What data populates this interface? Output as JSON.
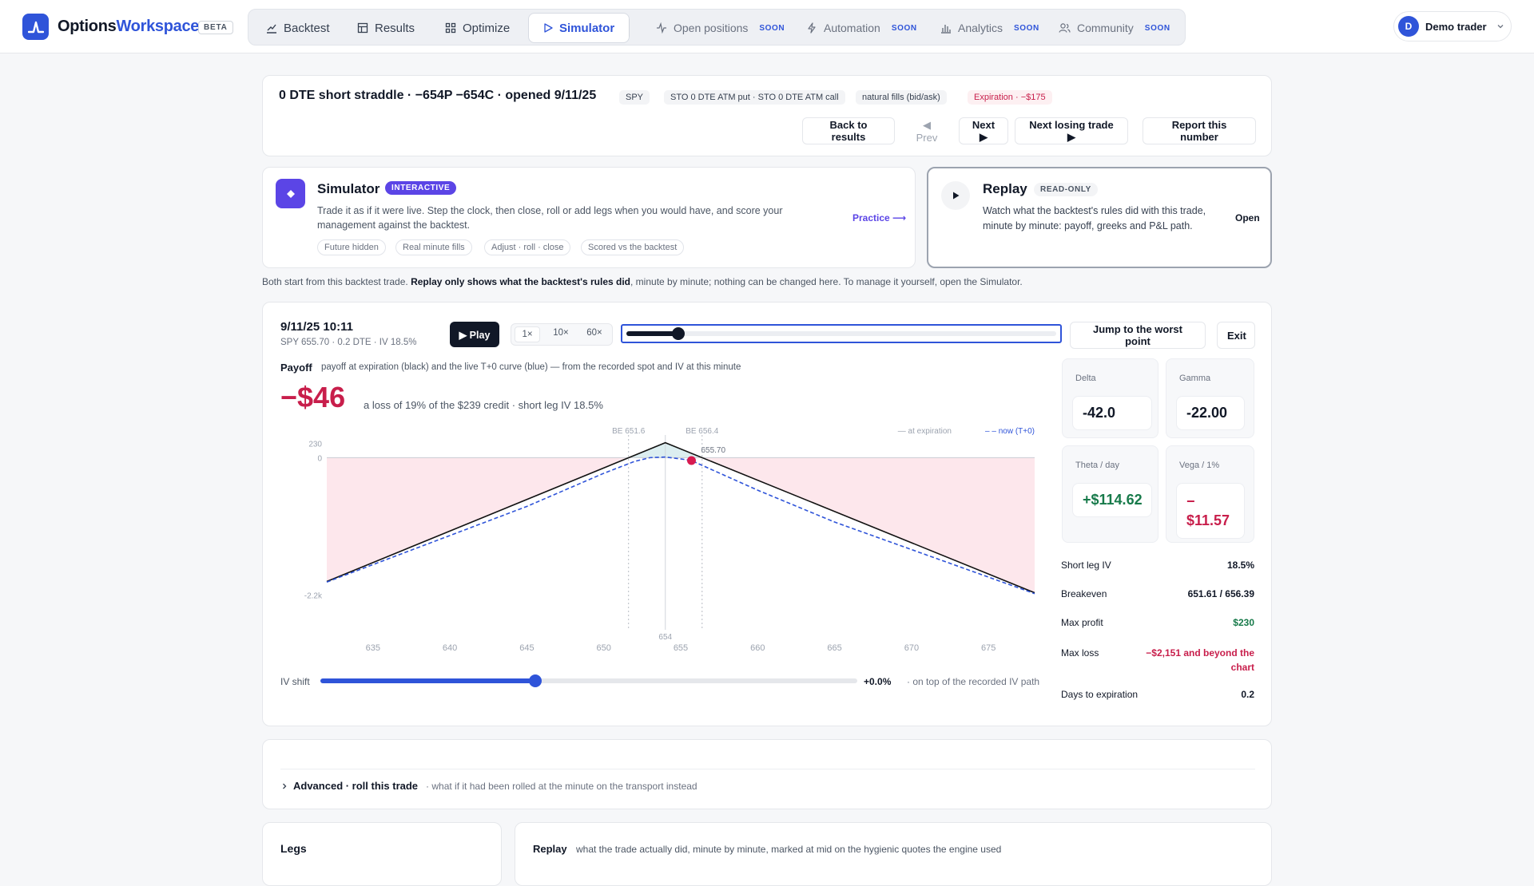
{
  "app": {
    "brand_a": "Options",
    "brand_b": "Workspace",
    "beta": "BETA"
  },
  "nav": {
    "items": [
      {
        "label": "Backtest"
      },
      {
        "label": "Results"
      },
      {
        "label": "Optimize"
      },
      {
        "label": "Simulator"
      }
    ],
    "soon_items": [
      {
        "label": "Open positions",
        "badge": "SOON"
      },
      {
        "label": "Automation",
        "badge": "SOON"
      },
      {
        "label": "Analytics",
        "badge": "SOON"
      },
      {
        "label": "Community",
        "badge": "SOON"
      }
    ]
  },
  "user": {
    "initial": "D",
    "name": "Demo trader"
  },
  "trade": {
    "title": "0 DTE short straddle · −654P −654C · opened 9/11/25",
    "tags": [
      "SPY",
      "STO 0 DTE ATM put · STO 0 DTE ATM call",
      "natural fills (bid/ask)"
    ],
    "exp_tag": "Expiration · −$175",
    "buttons": {
      "back": "Back to results",
      "prev": "◀ Prev",
      "next": "Next ▶",
      "next_losing": "Next losing trade ▶",
      "report": "Report this number"
    }
  },
  "simulator": {
    "title": "Simulator",
    "badge": "INTERACTIVE",
    "desc": "Trade it as if it were live. Step the clock, then close, roll or add legs when you would have, and score your management against the backtest.",
    "pills": [
      "Future hidden",
      "Real minute fills",
      "Adjust · roll · close",
      "Scored vs the backtest"
    ],
    "link": "Practice ⟶"
  },
  "replay_card": {
    "title": "Replay",
    "badge": "READ-ONLY",
    "desc": "Watch what the backtest's rules did with this trade, minute by minute: payoff, greeks and P&L path.",
    "open": "Open"
  },
  "note": {
    "a": "Both start from this backtest trade. ",
    "b": "Replay only shows what the backtest's rules did",
    "c": ", minute by minute; nothing can be changed here. To manage it yourself, open the Simulator."
  },
  "transport": {
    "time": "9/11/25 10:11",
    "sub": "SPY 655.70 · 0.2 DTE · IV 18.5%",
    "play": "▶ Play",
    "speeds": [
      "1×",
      "10×",
      "60×"
    ],
    "progress": 0.12,
    "jump": "Jump to the worst point",
    "exit": "Exit"
  },
  "payoff": {
    "label": "Payoff",
    "caption": "payoff at expiration (black) and the live T+0 curve (blue) — from the recorded spot and IV at this minute",
    "pnl": "−$46",
    "pnl_note": "a loss of 19% of the $239 credit · short leg IV 18.5%",
    "legend_exp": "— at expiration",
    "legend_now": "– – now (T+0)"
  },
  "chart_data": {
    "type": "line",
    "xlim": [
      632,
      678
    ],
    "ylim": [
      -2600,
      260
    ],
    "x_ticks": [
      635,
      640,
      645,
      650,
      655,
      660,
      665,
      670,
      675
    ],
    "y_tick_labels": [
      "230",
      "0",
      "-2.2k"
    ],
    "y_tick_values": [
      230,
      0,
      -2200
    ],
    "series": [
      {
        "x": [
          632,
          654,
          678
        ],
        "y": [
          -1981,
          239,
          -2161
        ]
      },
      {
        "x": [
          632,
          645,
          650,
          652,
          653,
          654,
          655,
          655.7,
          656,
          658,
          660,
          665,
          678
        ],
        "y": [
          -1990,
          -780,
          -250,
          -60,
          0,
          10,
          -20,
          -46,
          -80,
          -300,
          -520,
          -1030,
          -2175
        ]
      }
    ],
    "markers": {
      "be_low_label": "BE 651.6",
      "be_low": 651.61,
      "be_high_label": "BE 656.4",
      "be_high": 656.39,
      "strike_label": "654",
      "strike": 654,
      "spot_label": "655.70",
      "spot": 655.7,
      "spot_y": -46
    },
    "colors": {
      "expiration": "#111111",
      "t0": "#2f54d9",
      "loss_fill": "#fde7ec",
      "profit_fill": "#dceef0",
      "spot": "#d81b50"
    }
  },
  "iv": {
    "label": "IV shift",
    "value": "+0.0%",
    "note": "· on top of the recorded IV path",
    "position": 0.4
  },
  "greeks": [
    {
      "label": "Delta",
      "value": "-42.0"
    },
    {
      "label": "Gamma",
      "value": "-22.00"
    },
    {
      "label": "Theta / day",
      "value": "+$114.62"
    },
    {
      "label": "Vega / 1%",
      "value": "− $11.57"
    }
  ],
  "stats": [
    {
      "label": "Short leg IV",
      "value": "18.5%"
    },
    {
      "label": "Breakeven",
      "value": "651.61 / 656.39"
    },
    {
      "label": "Max profit",
      "value": "$230"
    },
    {
      "label": "Max loss",
      "value": "−$2,151 and beyond the chart"
    },
    {
      "label": "Days to expiration",
      "value": "0.2"
    }
  ],
  "advanced": {
    "title": "Advanced · roll this trade",
    "note": "· what if it had been rolled at the minute on the transport instead"
  },
  "legs": {
    "title": "Legs"
  },
  "replay_section": {
    "title": "Replay",
    "note": "what the trade actually did, minute by minute, marked at mid on the hygienic quotes the engine used"
  }
}
